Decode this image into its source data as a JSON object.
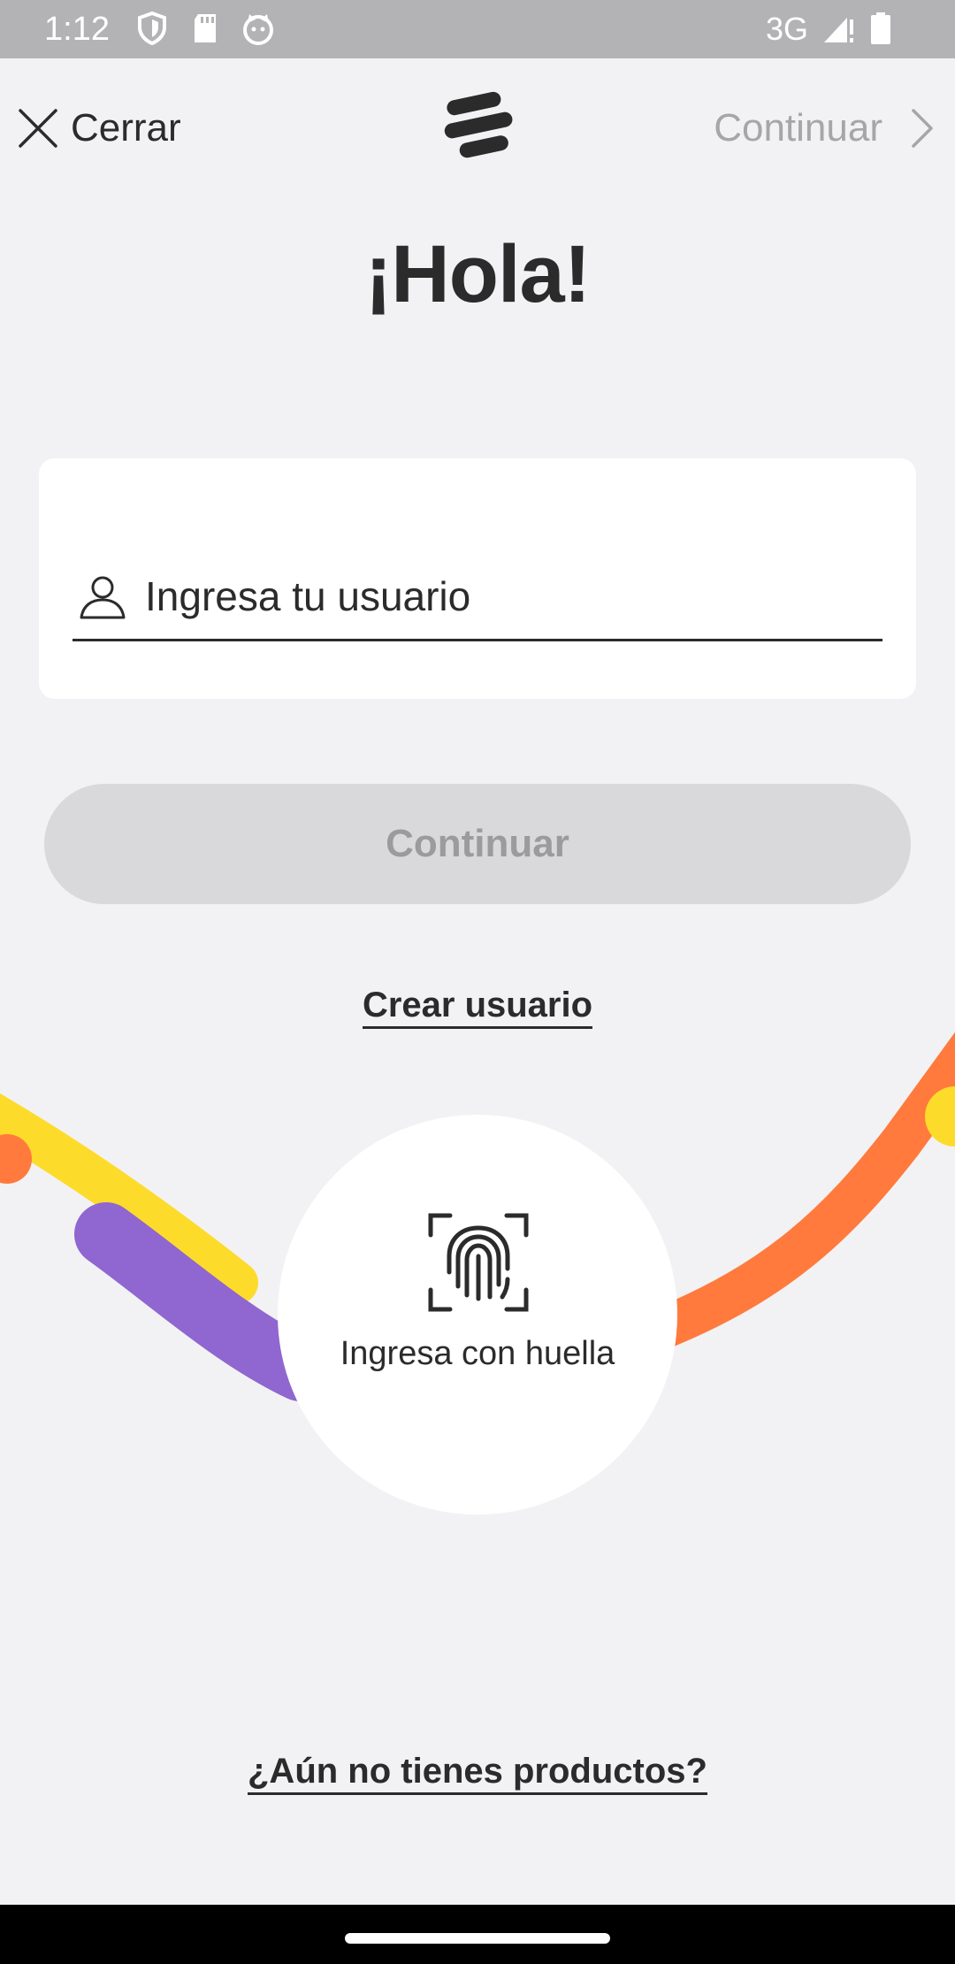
{
  "status_bar": {
    "time": "1:12",
    "network": "3G",
    "icons": [
      "shield-icon",
      "sd-card-icon",
      "cat-icon",
      "signal-icon",
      "battery-icon"
    ]
  },
  "top_nav": {
    "close_label": "Cerrar",
    "continue_label": "Continuar",
    "icons": [
      "close-icon",
      "logo-icon",
      "chevron-right-icon"
    ]
  },
  "greeting": "¡Hola!",
  "login": {
    "user_placeholder": "Ingresa tu usuario",
    "user_value": "",
    "continue_label": "Continuar",
    "create_user_label": "Crear usuario"
  },
  "biometric": {
    "label": "Ingresa con huella",
    "icon": "fingerprint-icon"
  },
  "footer": {
    "products_link": "¿Aún no tienes productos?"
  },
  "colors": {
    "background": "#f2f2f4",
    "text": "#2b2b2b",
    "disabled_button": "#d9d9dc",
    "disabled_text": "#9b9b9e",
    "stripe_yellow": "#fddb2b",
    "stripe_purple": "#9066d0",
    "stripe_orange": "#ff7a3c"
  }
}
